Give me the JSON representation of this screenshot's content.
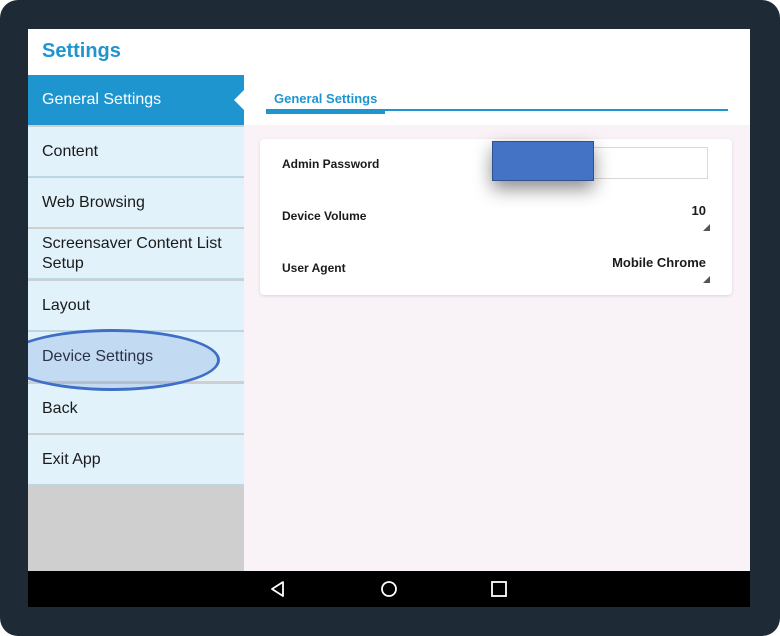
{
  "app": {
    "title": "Settings"
  },
  "sidebar": {
    "items": [
      {
        "label": "General Settings",
        "active": true
      },
      {
        "label": "Content",
        "active": false
      },
      {
        "label": "Web Browsing",
        "active": false
      },
      {
        "label": "Screensaver Content List Setup",
        "active": false
      },
      {
        "label": "Layout",
        "active": false
      },
      {
        "label": "Device Settings",
        "active": false
      },
      {
        "label": "Back",
        "active": false
      },
      {
        "label": "Exit App",
        "active": false
      }
    ]
  },
  "main": {
    "tab": {
      "label": "General Settings"
    },
    "settings": {
      "admin_password": {
        "label": "Admin Password",
        "value": ""
      },
      "device_volume": {
        "label": "Device Volume",
        "value": "10"
      },
      "user_agent": {
        "label": "User Agent",
        "value": "Mobile Chrome"
      }
    }
  },
  "navbar": {
    "buttons": [
      "back-triangle-icon",
      "home-circle-icon",
      "recents-square-icon"
    ]
  },
  "colors": {
    "accent": "#1f95cf",
    "sidebar_item_bg": "#e1f2fb",
    "panel_bg": "#f9f2f7",
    "redaction": "#4472c4",
    "highlight_ring": "#3f6fc4",
    "device_frame": "#1f2a37"
  }
}
